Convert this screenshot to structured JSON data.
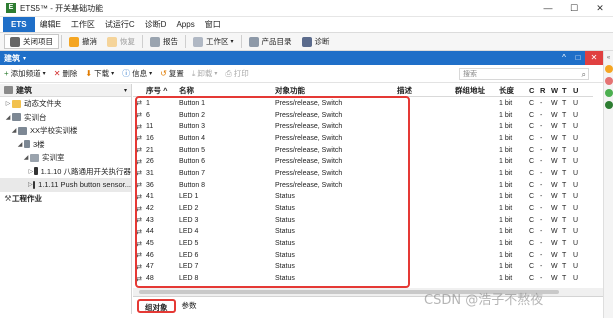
{
  "window": {
    "title": "ETS5™ - 开关基础功能",
    "controls": [
      "—",
      "☐",
      "✕"
    ]
  },
  "menu": {
    "ets": "ETS",
    "items": [
      "编辑E",
      "工作区",
      "试运行C",
      "诊断D",
      "Apps",
      "窗口"
    ]
  },
  "toolbar": {
    "close_project": "关闭项目",
    "undo": "撤消",
    "redo": "恢复",
    "report": "报告",
    "workspace": "工作区",
    "catalog": "产品目录",
    "diagnostics": "诊断"
  },
  "panel": {
    "title": "建筑",
    "controls": [
      "^",
      "□",
      "✕"
    ]
  },
  "toolbar2": {
    "add_channel": "添加频道",
    "delete": "删除",
    "download": "下载",
    "info": "信息",
    "reset": "复置",
    "unload": "卸载",
    "print": "打印",
    "search_placeholder": "搜索"
  },
  "tree": {
    "header": "建筑",
    "items": [
      {
        "label": "动态文件夹",
        "indent": 1
      },
      {
        "label": "实训台",
        "indent": 1
      },
      {
        "label": "XX学校实训楼",
        "indent": 2
      },
      {
        "label": "3楼",
        "indent": 3
      },
      {
        "label": "实训室",
        "indent": 4
      },
      {
        "label": "1.1.10 八路通用开关执行器",
        "indent": 5
      },
      {
        "label": "1.1.11 Push button sensor...",
        "indent": 5
      },
      {
        "label": "工程作业",
        "indent": 0
      }
    ]
  },
  "grid": {
    "columns": {
      "num": "序号 ^",
      "name": "名称",
      "function": "对象功能",
      "desc": "描述",
      "group": "群组地址",
      "length": "长度",
      "c": "C",
      "r": "R",
      "w": "W",
      "t": "T",
      "u": "U"
    },
    "rows": [
      {
        "num": "1",
        "name": "Button 1",
        "func": "Press/release, Switch",
        "len": "1 bit",
        "c": "C",
        "r": "-",
        "w": "W",
        "t": "T",
        "u": "U"
      },
      {
        "num": "6",
        "name": "Button 2",
        "func": "Press/release, Switch",
        "len": "1 bit",
        "c": "C",
        "r": "-",
        "w": "W",
        "t": "T",
        "u": "U"
      },
      {
        "num": "11",
        "name": "Button 3",
        "func": "Press/release, Switch",
        "len": "1 bit",
        "c": "C",
        "r": "-",
        "w": "W",
        "t": "T",
        "u": "U"
      },
      {
        "num": "16",
        "name": "Button 4",
        "func": "Press/release, Switch",
        "len": "1 bit",
        "c": "C",
        "r": "-",
        "w": "W",
        "t": "T",
        "u": "U"
      },
      {
        "num": "21",
        "name": "Button 5",
        "func": "Press/release, Switch",
        "len": "1 bit",
        "c": "C",
        "r": "-",
        "w": "W",
        "t": "T",
        "u": "U"
      },
      {
        "num": "26",
        "name": "Button 6",
        "func": "Press/release, Switch",
        "len": "1 bit",
        "c": "C",
        "r": "-",
        "w": "W",
        "t": "T",
        "u": "U"
      },
      {
        "num": "31",
        "name": "Button 7",
        "func": "Press/release, Switch",
        "len": "1 bit",
        "c": "C",
        "r": "-",
        "w": "W",
        "t": "T",
        "u": "U"
      },
      {
        "num": "36",
        "name": "Button 8",
        "func": "Press/release, Switch",
        "len": "1 bit",
        "c": "C",
        "r": "-",
        "w": "W",
        "t": "T",
        "u": "U"
      },
      {
        "num": "41",
        "name": "LED 1",
        "func": "Status",
        "len": "1 bit",
        "c": "C",
        "r": "-",
        "w": "W",
        "t": "T",
        "u": "U"
      },
      {
        "num": "42",
        "name": "LED 2",
        "func": "Status",
        "len": "1 bit",
        "c": "C",
        "r": "-",
        "w": "W",
        "t": "T",
        "u": "U"
      },
      {
        "num": "43",
        "name": "LED 3",
        "func": "Status",
        "len": "1 bit",
        "c": "C",
        "r": "-",
        "w": "W",
        "t": "T",
        "u": "U"
      },
      {
        "num": "44",
        "name": "LED 4",
        "func": "Status",
        "len": "1 bit",
        "c": "C",
        "r": "-",
        "w": "W",
        "t": "T",
        "u": "U"
      },
      {
        "num": "45",
        "name": "LED 5",
        "func": "Status",
        "len": "1 bit",
        "c": "C",
        "r": "-",
        "w": "W",
        "t": "T",
        "u": "U"
      },
      {
        "num": "46",
        "name": "LED 6",
        "func": "Status",
        "len": "1 bit",
        "c": "C",
        "r": "-",
        "w": "W",
        "t": "T",
        "u": "U"
      },
      {
        "num": "47",
        "name": "LED 7",
        "func": "Status",
        "len": "1 bit",
        "c": "C",
        "r": "-",
        "w": "W",
        "t": "T",
        "u": "U"
      },
      {
        "num": "48",
        "name": "LED 8",
        "func": "Status",
        "len": "1 bit",
        "c": "C",
        "r": "-",
        "w": "W",
        "t": "T",
        "u": "U"
      }
    ]
  },
  "tabs": [
    "组对象",
    "参数"
  ],
  "watermark": "CSDN @浩子不熬夜",
  "colors": {
    "accent": "#1f6fc8",
    "highlight": "#e53935"
  }
}
